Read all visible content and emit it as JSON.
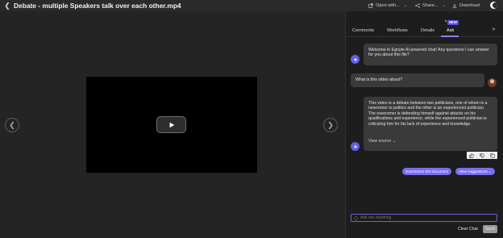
{
  "file": {
    "title": "Debate - multiple Speakers talk over each other.mp4"
  },
  "toolbar": {
    "open_with_label": "Open with...",
    "share_label": "Share...",
    "download_label": "Download"
  },
  "panel": {
    "tabs": [
      {
        "label": "Comments"
      },
      {
        "label": "Workflows"
      },
      {
        "label": "Details"
      },
      {
        "label": "Ask",
        "active": true
      }
    ],
    "new_badge": "NEW"
  },
  "chat": {
    "welcome": "Welcome to Egnyte AI powered chat! Any questions I can answer for you about this file?",
    "user_question": "What is this video about?",
    "answer": "This video is a debate between two politicians, one of whom is a newcomer to politics and the other is an experienced politician. The newcomer is defending himself against attacks on his qualifications and experience, while the experienced politician is criticizing him for his lack of experience and knowledge.",
    "view_source_label": "View source",
    "suggestions": [
      "Summarize this document",
      "View suggestions"
    ],
    "input_placeholder": "Ask me anything",
    "clear_label": "Clear Chat",
    "send_label": "Send"
  },
  "colors": {
    "accent": "#7b6cf0",
    "accent_dark": "#5b4ee0",
    "background": "#262626",
    "panel": "#1d1d1d"
  }
}
